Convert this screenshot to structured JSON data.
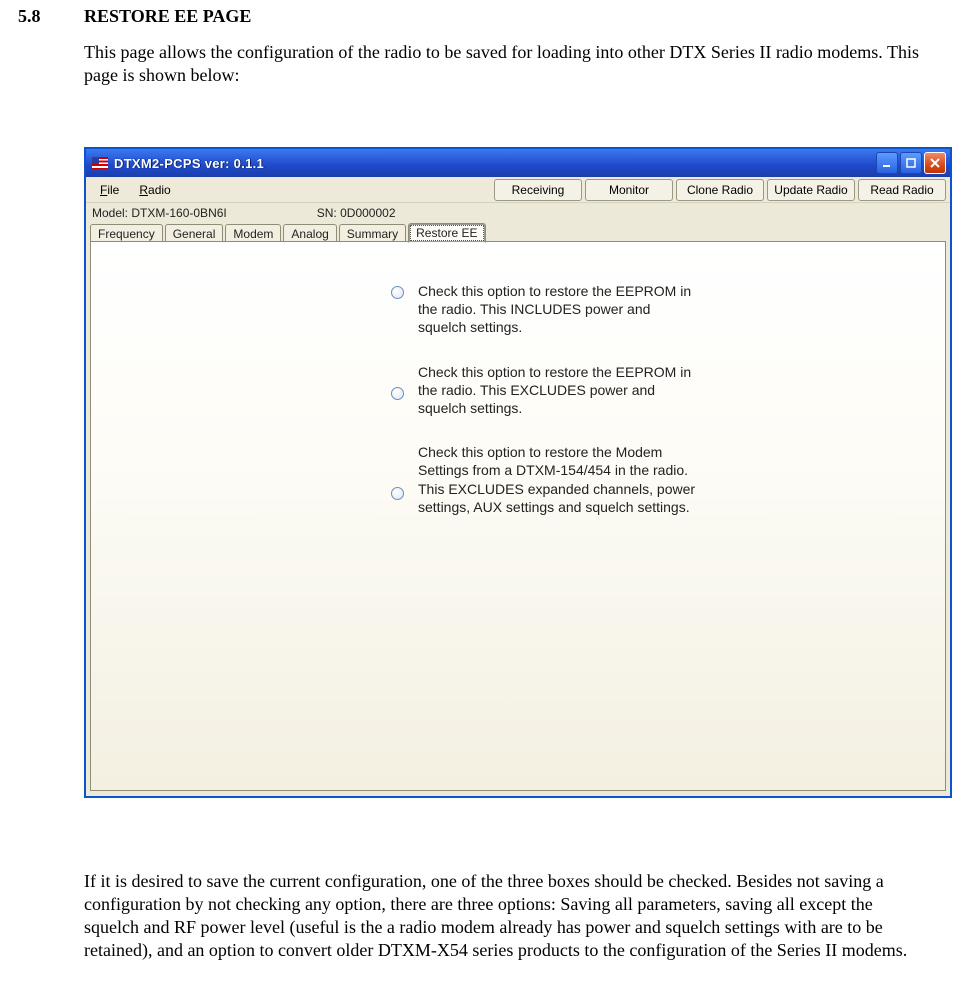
{
  "doc": {
    "section_number": "5.8",
    "section_title": "RESTORE EE PAGE",
    "intro": "This page allows the configuration of the radio to be saved for loading into other DTX Series II radio modems. This page is shown below:",
    "footer": "If it is desired to save the current configuration, one of the three boxes should be checked. Besides not saving a configuration by not checking any option, there are three options: Saving all parameters, saving all except the squelch and RF power level (useful is the a radio modem already has power and squelch settings with are to be retained), and an option to convert older DTXM-X54 series products to the configuration of the Series II modems."
  },
  "app": {
    "title": "DTXM2-PCPS ver: 0.1.1",
    "menu": {
      "file": "File",
      "radio": "Radio"
    },
    "toolbar": {
      "receiving": "Receiving",
      "monitor": "Monitor",
      "clone": "Clone Radio",
      "update": "Update Radio",
      "read": "Read Radio"
    },
    "info": {
      "model_label": "Model:",
      "model_value": "DTXM-160-0BN6I",
      "sn_label": "SN:",
      "sn_value": "0D000002"
    },
    "tabs": {
      "frequency": "Frequency",
      "general": "General",
      "modem": "Modem",
      "analog": "Analog",
      "summary": "Summary",
      "restore": "Restore EE"
    },
    "options": {
      "opt1": "Check this option to restore the EEPROM in the radio. This INCLUDES power and squelch settings.",
      "opt2": "Check this option to restore the EEPROM in the radio. This EXCLUDES power and squelch settings.",
      "opt3": "Check this option to restore the Modem Settings from a DTXM-154/454 in the radio. This EXCLUDES expanded channels, power settings, AUX settings and squelch settings."
    }
  }
}
